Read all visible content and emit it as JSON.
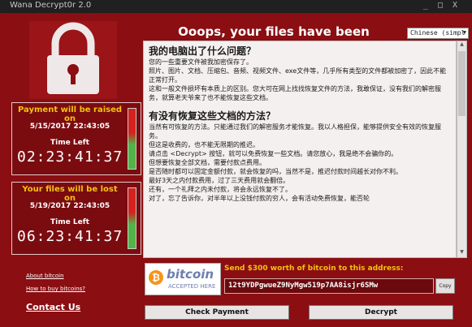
{
  "window": {
    "title": "Wana Decrypt0r 2.0",
    "controls": [
      "_",
      "□",
      "X"
    ]
  },
  "header": {
    "title": "Ooops, your files have been encrypted!"
  },
  "language": {
    "selected": "Chinese (simpl"
  },
  "timer1": {
    "heading": "Payment will be raised on",
    "date": "5/15/2017 22:43:05",
    "label": "Time Left",
    "countdown": "02:23:41:37"
  },
  "timer2": {
    "heading": "Your files will be lost on",
    "date": "5/19/2017 22:43:05",
    "label": "Time Left",
    "countdown": "06:23:41:37"
  },
  "links": {
    "about": "About bitcoin",
    "how_to_buy": "How to buy bitcoins?",
    "contact": "Contact Us"
  },
  "content": {
    "heading1": "我的电脑出了什么问题？",
    "paragraph1": "您的一些重要文件被我加密保存了。",
    "paragraph2": "照片、图片、文档、压缩包、音频、视频文件、exe文件等，几乎所有类型的文件都被加密了，因此不能正常打开。",
    "paragraph3": "这和一般文件损坏有本质上的区别。您大可在网上找找恢复文件的方法，我敢保证，没有我们的解密服务，就算老天爷来了也不能恢复这些文档。",
    "heading2": "有没有恢复这些文档的方法？",
    "paragraph4": "当然有可恢复的方法。只能通过我们的解密服务才能恢复。我以人格担保，能够提供安全有效的恢复服务。",
    "paragraph5": "但这是收费的，也不能无限期的推迟。",
    "paragraph6": "请点击 <Decrypt> 按钮，就可以免费恢复一些文档。请您放心，我是绝不会骗你的。",
    "paragraph7": "但想要恢复全部文档，需要付款点费用。",
    "paragraph8": "是否随时都可以固定金额付款，就会恢复的吗，当然不是，推迟付款时间越长对你不利。",
    "paragraph9": "最好3天之内付款费用，过了三天费用就会翻倍。",
    "paragraph10": "还有，一个礼拜之内未付款，将会永远恢复不了。",
    "paragraph11": "对了，忘了告诉你，对半年以上没钱付款的穷人，会有活动免费恢复，能否轮"
  },
  "bitcoin": {
    "logo_word": "bitcoin",
    "logo_sub": "ACCEPTED HERE",
    "send_text": "Send $300 worth of bitcoin to this address:",
    "address": "12t9YDPgwueZ9NyMgw519p7AA8isjr6SMw",
    "copy_label": "Copy"
  },
  "buttons": {
    "check_payment": "Check Payment",
    "decrypt": "Decrypt"
  },
  "colors": {
    "background": "#8a0e12",
    "accent": "#f4c20d",
    "text_light": "#ffffff"
  }
}
